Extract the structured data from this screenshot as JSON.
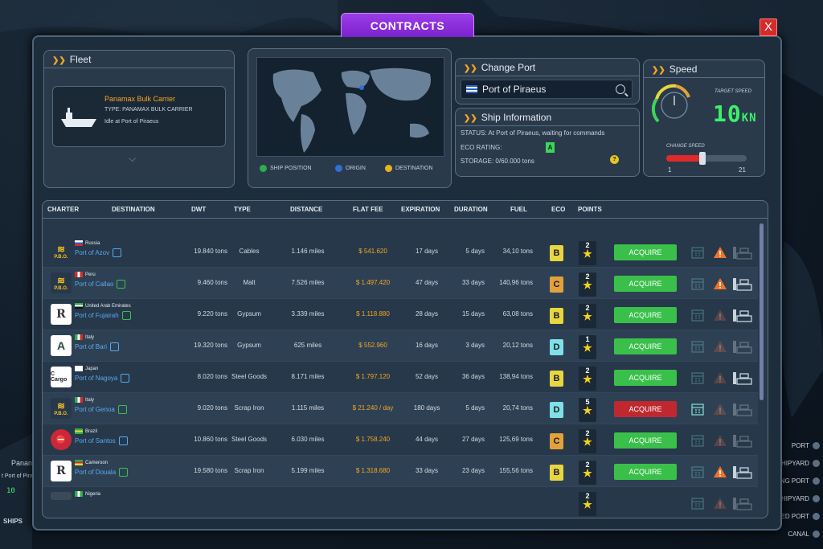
{
  "window": {
    "title": "CONTRACTS",
    "close_label": "X"
  },
  "fleet": {
    "title": "Fleet",
    "ship_name": "Panamax Bulk Carrier",
    "ship_type": "TYPE: PANAMAX BULK CARRIER",
    "ship_status": "Idle at Port of Piraeus"
  },
  "map": {
    "legend": [
      {
        "label": "SHIP POSITION",
        "color": "#2fae4a"
      },
      {
        "label": "ORIGIN",
        "color": "#2f6fd6"
      },
      {
        "label": "DESTINATION",
        "color": "#e6b422"
      }
    ]
  },
  "change_port": {
    "title": "Change Port",
    "value": "Port of Piraeus"
  },
  "ship_info": {
    "title": "Ship Information",
    "status": "STATUS: At Port of Piraeus, waiting for commands",
    "eco_label": "ECO RATING:",
    "eco_value": "A",
    "storage": "STORAGE: 0/60.000 tons",
    "help": "?"
  },
  "speed": {
    "title": "Speed",
    "target_label": "TARGET SPEED",
    "target_value": "10",
    "target_unit": "KN",
    "change_label": "CHANGE SPEED",
    "min": "1",
    "max": "21",
    "level": 0.45
  },
  "table": {
    "headers": [
      "CHARTER",
      "DESTINATION",
      "DWT",
      "TYPE",
      "DISTANCE",
      "FLAT FEE",
      "EXPIRATION",
      "DURATION",
      "FUEL",
      "ECO",
      "POINTS"
    ],
    "rows": [
      {
        "logo": "P.B.O.",
        "logo_kind": "pbo",
        "country": "Russia",
        "port": "Port of Azov",
        "link_color": "#58a9f0",
        "dwt": "19.840 tons",
        "type": "Cables",
        "distance": "1.146 miles",
        "fee": "$ 541.620",
        "expiration": "17 days",
        "duration": "5 days",
        "fuel": "34,10 tons",
        "eco": "B",
        "points": "2",
        "action": "ACQUIRE",
        "action_kind": "green",
        "warn": true,
        "load": false,
        "cal": false
      },
      {
        "logo": "P.B.O.",
        "logo_kind": "pbo",
        "country": "Peru",
        "port": "Port of Callao",
        "link_color": "#3ac04a",
        "dwt": "9.460 tons",
        "type": "Malt",
        "distance": "7.526 miles",
        "fee": "$ 1.497.420",
        "expiration": "47 days",
        "duration": "33 days",
        "fuel": "140,96 tons",
        "eco": "C",
        "points": "2",
        "action": "ACQUIRE",
        "action_kind": "green",
        "warn": true,
        "load": true,
        "cal": false
      },
      {
        "logo": "R",
        "logo_kind": "r",
        "country": "United Arab Emirates",
        "port": "Port of Fujairah",
        "link_color": "#3ac04a",
        "dwt": "9.220 tons",
        "type": "Gypsum",
        "distance": "3.339 miles",
        "fee": "$ 1.118.880",
        "expiration": "28 days",
        "duration": "15 days",
        "fuel": "63,08 tons",
        "eco": "B",
        "points": "2",
        "action": "ACQUIRE",
        "action_kind": "green",
        "warn": false,
        "load": true,
        "cal": false
      },
      {
        "logo": "A",
        "logo_kind": "a",
        "country": "Italy",
        "port": "Port of Bari",
        "link_color": "#58a9f0",
        "dwt": "19.320 tons",
        "type": "Gypsum",
        "distance": "625 miles",
        "fee": "$ 552.960",
        "expiration": "16 days",
        "duration": "3 days",
        "fuel": "20,12 tons",
        "eco": "D",
        "points": "1",
        "action": "ACQUIRE",
        "action_kind": "green",
        "warn": false,
        "load": false,
        "cal": false
      },
      {
        "logo": "C Cargo",
        "logo_kind": "cargo",
        "country": "Japan",
        "port": "Port of Nagoya",
        "link_color": "#58a9f0",
        "dwt": "8.020 tons",
        "type": "Steel Goods",
        "distance": "8.171 miles",
        "fee": "$ 1.797.120",
        "expiration": "52 days",
        "duration": "36 days",
        "fuel": "138,94 tons",
        "eco": "B",
        "points": "2",
        "action": "ACQUIRE",
        "action_kind": "green",
        "warn": false,
        "load": true,
        "cal": false
      },
      {
        "logo": "P.B.O.",
        "logo_kind": "pbo",
        "country": "Italy",
        "port": "Port of Genoa",
        "link_color": "#3ac04a",
        "dwt": "9.020 tons",
        "type": "Scrap Iron",
        "distance": "1.115 miles",
        "fee": "$ 21.240 / day",
        "expiration": "180 days",
        "duration": "5 days",
        "fuel": "20,74 tons",
        "eco": "D",
        "points": "5",
        "action": "ACQUIRE",
        "action_kind": "red",
        "warn": false,
        "load": false,
        "cal": true
      },
      {
        "logo": "",
        "logo_kind": "stop",
        "country": "Brazil",
        "port": "Port of Santos",
        "link_color": "#58a9f0",
        "dwt": "10.860 tons",
        "type": "Steel Goods",
        "distance": "6.030 miles",
        "fee": "$ 1.758.240",
        "expiration": "44 days",
        "duration": "27 days",
        "fuel": "125,69 tons",
        "eco": "C",
        "points": "2",
        "action": "ACQUIRE",
        "action_kind": "green",
        "warn": false,
        "load": false,
        "cal": false
      },
      {
        "logo": "R",
        "logo_kind": "r",
        "country": "Cameroon",
        "port": "Port of Douala",
        "link_color": "#3ac04a",
        "dwt": "19.580 tons",
        "type": "Scrap Iron",
        "distance": "5.199 miles",
        "fee": "$ 1.318.680",
        "expiration": "33 days",
        "duration": "23 days",
        "fuel": "155,56 tons",
        "eco": "B",
        "points": "2",
        "action": "ACQUIRE",
        "action_kind": "green",
        "warn": true,
        "load": true,
        "cal": false
      },
      {
        "logo": "",
        "logo_kind": "partial",
        "country": "Nigeria",
        "port": "",
        "link_color": "#3ac04a",
        "dwt": "",
        "type": "",
        "distance": "",
        "fee": "",
        "expiration": "",
        "duration": "",
        "fuel": "",
        "eco": "",
        "points": "2",
        "action": "",
        "action_kind": "none",
        "warn": false,
        "load": false,
        "cal": false
      }
    ]
  },
  "sidebar_right": [
    "PORT",
    "SHIPYARD",
    "LNG PORT",
    "SHIPYARD",
    "SED PORT",
    "CANAL"
  ],
  "bottom_left": {
    "ships_label": "SHIPS",
    "ship_name_partial": "Panan",
    "port_partial": "t Port of Pira",
    "speed_partial": "10"
  },
  "eco_colors": {
    "A": "#3cd65a",
    "B": "#e8d640",
    "C": "#e2a13a",
    "D": "#7ee0e8"
  }
}
